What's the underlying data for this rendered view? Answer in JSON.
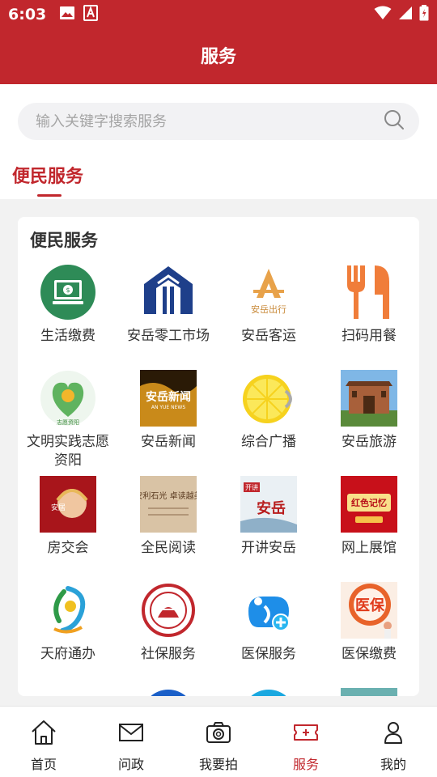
{
  "status_bar": {
    "time": "6:03"
  },
  "header": {
    "title": "服务"
  },
  "search": {
    "placeholder": "输入关键字搜索服务"
  },
  "tabs": [
    {
      "label": "便民服务",
      "active": true
    }
  ],
  "card": {
    "title": "便民服务",
    "items": [
      {
        "label": "生活缴费",
        "icon": "bill-payment-icon"
      },
      {
        "label": "安岳零工市场",
        "icon": "labor-market-icon"
      },
      {
        "label": "安岳客运",
        "icon": "anyue-transport-icon"
      },
      {
        "label": "扫码用餐",
        "icon": "fork-knife-icon"
      },
      {
        "label": "文明实践志愿资阳",
        "icon": "volunteer-icon"
      },
      {
        "label": "安岳新闻",
        "icon": "anyue-news-icon"
      },
      {
        "label": "综合广播",
        "icon": "lemon-radio-icon"
      },
      {
        "label": "安岳旅游",
        "icon": "tourism-gate-icon"
      },
      {
        "label": "房交会",
        "icon": "house-fair-icon"
      },
      {
        "label": "全民阅读",
        "icon": "reading-icon"
      },
      {
        "label": "开讲安岳",
        "icon": "lecture-icon"
      },
      {
        "label": "网上展馆",
        "icon": "online-exhibition-icon"
      },
      {
        "label": "天府通办",
        "icon": "tianfu-icon"
      },
      {
        "label": "社保服务",
        "icon": "social-security-icon"
      },
      {
        "label": "医保服务",
        "icon": "medical-insurance-icon"
      },
      {
        "label": "医保缴费",
        "icon": "medical-payment-icon"
      }
    ]
  },
  "icon_text": {
    "transport": "安岳出行",
    "news": "安岳新闻",
    "news_en": "AN YUE NEWS",
    "volunteer": "志愿资阳",
    "house": "安居",
    "reading": "安利石光 卓读越美",
    "lecture_badge": "开讲",
    "lecture": "安岳",
    "exhibition": "红色记忆",
    "medical": "医保"
  },
  "nav": [
    {
      "label": "首页",
      "icon": "home-icon",
      "active": false
    },
    {
      "label": "问政",
      "icon": "mail-icon",
      "active": false
    },
    {
      "label": "我要拍",
      "icon": "camera-icon",
      "active": false
    },
    {
      "label": "服务",
      "icon": "ticket-service-icon",
      "active": true
    },
    {
      "label": "我的",
      "icon": "user-icon",
      "active": false
    }
  ],
  "colors": {
    "brand": "#c1272d",
    "active_nav": "#c1272d"
  }
}
